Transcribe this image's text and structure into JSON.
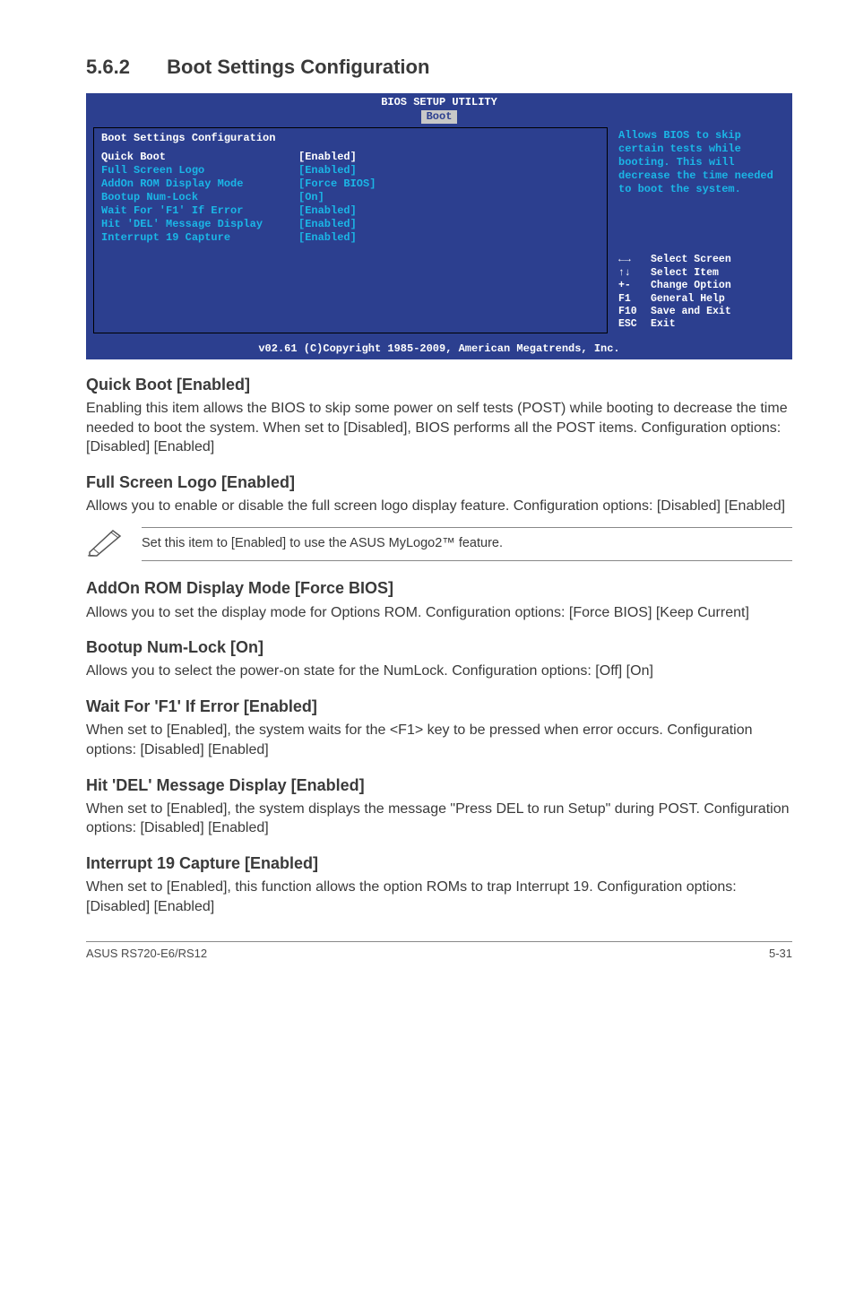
{
  "section": {
    "number": "5.6.2",
    "title": "Boot Settings Configuration"
  },
  "bios": {
    "title": "BIOS SETUP UTILITY",
    "tab": "Boot",
    "panel_header": "Boot Settings Configuration",
    "items": [
      {
        "label": "Quick Boot",
        "value": "[Enabled]",
        "selected": true
      },
      {
        "label": "Full Screen Logo",
        "value": "[Enabled]"
      },
      {
        "label": "AddOn ROM Display Mode",
        "value": "[Force BIOS]"
      },
      {
        "label": "Bootup Num-Lock",
        "value": "[On]"
      },
      {
        "label": "Wait For 'F1' If Error",
        "value": "[Enabled]"
      },
      {
        "label": "Hit 'DEL' Message Display",
        "value": "[Enabled]"
      },
      {
        "label": "Interrupt 19 Capture",
        "value": "[Enabled]"
      }
    ],
    "help": "Allows BIOS to skip certain tests while booting. This will decrease the time needed to boot the system.",
    "keys": [
      {
        "k": "←→",
        "d": "Select Screen"
      },
      {
        "k": "↑↓",
        "d": "Select Item"
      },
      {
        "k": "+-",
        "d": "Change Option"
      },
      {
        "k": "F1",
        "d": "General Help"
      },
      {
        "k": "F10",
        "d": "Save and Exit"
      },
      {
        "k": "ESC",
        "d": "Exit"
      }
    ],
    "footer": "v02.61 (C)Copyright 1985-2009, American Megatrends, Inc."
  },
  "entries": {
    "quick_boot": {
      "heading": "Quick Boot [Enabled]",
      "body": "Enabling this item allows the BIOS to skip some power on self tests (POST) while booting to decrease the time needed to boot the system. When set to [Disabled], BIOS performs all the POST items. Configuration options: [Disabled] [Enabled]"
    },
    "full_screen_logo": {
      "heading": "Full Screen Logo [Enabled]",
      "body": "Allows you to enable or disable the full screen logo display feature. Configuration options: [Disabled] [Enabled]"
    },
    "note": "Set this item to [Enabled] to use the ASUS MyLogo2™ feature.",
    "addon_rom": {
      "heading": "AddOn ROM Display Mode [Force BIOS]",
      "body": "Allows you to set the display mode for Options ROM. Configuration options: [Force BIOS] [Keep Current]"
    },
    "bootup_numlock": {
      "heading": "Bootup Num-Lock [On]",
      "body": "Allows you to select the power-on state for the NumLock. Configuration options: [Off] [On]"
    },
    "wait_f1": {
      "heading": "Wait For 'F1' If Error [Enabled]",
      "body": "When set to [Enabled], the system waits for the <F1> key to be pressed when error occurs. Configuration options: [Disabled] [Enabled]"
    },
    "hit_del": {
      "heading": "Hit 'DEL' Message Display [Enabled]",
      "body": "When set to [Enabled], the system displays the message \"Press DEL to run Setup\" during POST. Configuration options: [Disabled] [Enabled]"
    },
    "interrupt19": {
      "heading": "Interrupt 19 Capture [Enabled]",
      "body": "When set to [Enabled], this function allows the option ROMs to trap Interrupt 19. Configuration options: [Disabled] [Enabled]"
    }
  },
  "footer": {
    "left": "ASUS RS720-E6/RS12",
    "right": "5-31"
  }
}
